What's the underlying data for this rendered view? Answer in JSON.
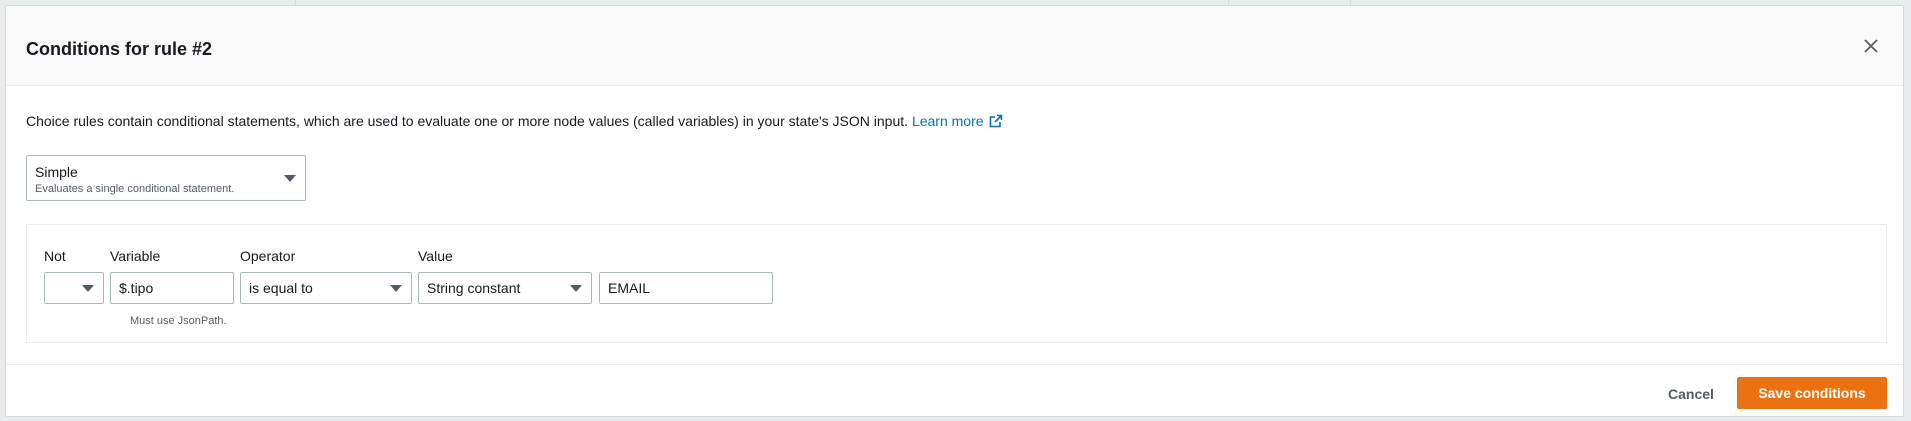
{
  "modal": {
    "title": "Conditions for rule #2"
  },
  "intro": {
    "text": "Choice rules contain conditional statements, which are used to evaluate one or more node values (called variables) in your state's JSON input.",
    "learn_more": "Learn more"
  },
  "mode_select": {
    "label": "Simple",
    "description": "Evaluates a single conditional statement."
  },
  "condition": {
    "not_label": "Not",
    "not_value": "",
    "variable_label": "Variable",
    "variable_value": "$.tipo",
    "variable_hint": "Must use JsonPath.",
    "operator_label": "Operator",
    "operator_value": "is equal to",
    "value_label": "Value",
    "value_type": "String constant",
    "value_value": "EMAIL"
  },
  "footer": {
    "cancel_label": "Cancel",
    "save_label": "Save conditions"
  },
  "colors": {
    "primary_button": "#ec7211",
    "link": "#0073bb",
    "border": "#aab7b8"
  },
  "icons": {
    "close": "close-icon",
    "external_link": "external-link-icon",
    "dropdown": "caret-down-icon"
  }
}
